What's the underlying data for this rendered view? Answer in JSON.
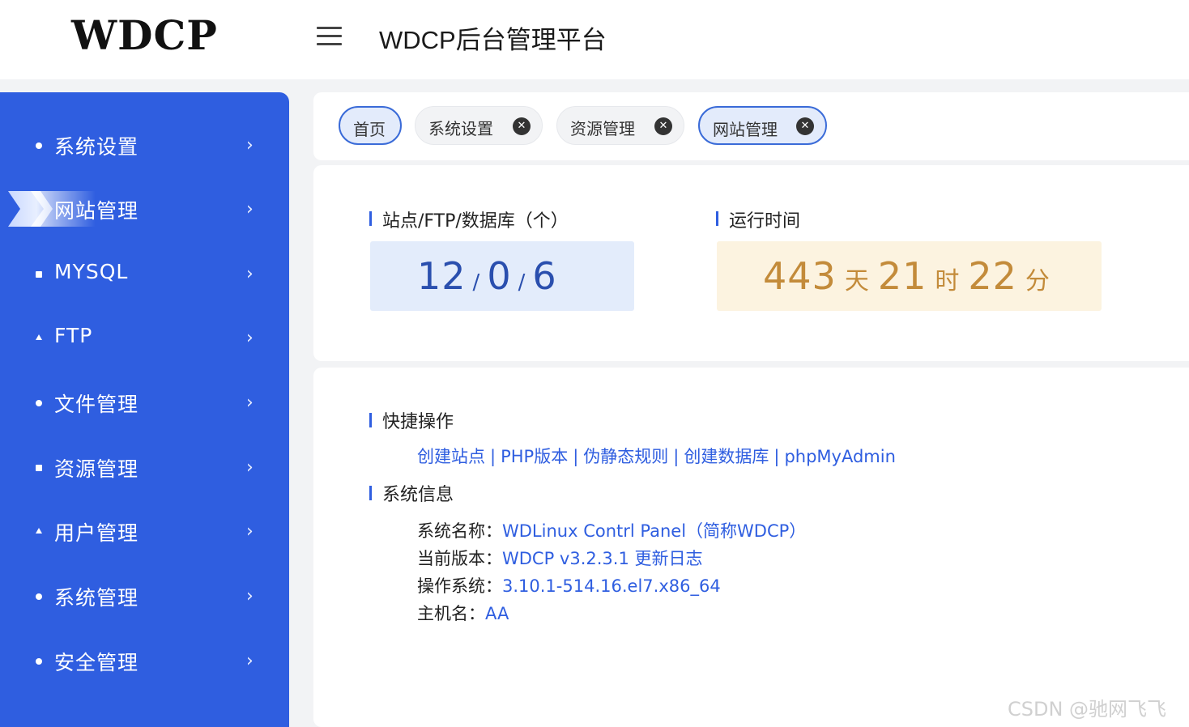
{
  "header": {
    "logo_text": "WDCP",
    "title": "WDCP后台管理平台"
  },
  "sidebar": {
    "items": [
      {
        "label": "系统设置",
        "bullet": "dot"
      },
      {
        "label": "网站管理",
        "bullet": "active"
      },
      {
        "label": "MYSQL",
        "bullet": "square"
      },
      {
        "label": "FTP",
        "bullet": "triangle"
      },
      {
        "label": "文件管理",
        "bullet": "dot"
      },
      {
        "label": "资源管理",
        "bullet": "square"
      },
      {
        "label": "用户管理",
        "bullet": "triangle"
      },
      {
        "label": "系统管理",
        "bullet": "dot"
      },
      {
        "label": "安全管理",
        "bullet": "dot"
      }
    ],
    "chevron": "›",
    "active_index": 1
  },
  "tabs": [
    {
      "label": "首页",
      "closable": false,
      "selected": true
    },
    {
      "label": "系统设置",
      "closable": true,
      "selected": false
    },
    {
      "label": "资源管理",
      "closable": true,
      "selected": false
    },
    {
      "label": "网站管理",
      "closable": true,
      "selected": true
    }
  ],
  "stats": {
    "sites_title": "站点/FTP/数据库（个）",
    "sites": "12",
    "ftp": "0",
    "databases": "6",
    "separator": "/",
    "uptime_title": "运行时间",
    "uptime_days": "443",
    "uptime_days_unit": "天",
    "uptime_hours": "21",
    "uptime_hours_unit": "时",
    "uptime_minutes": "22",
    "uptime_minutes_unit": "分"
  },
  "quick_actions": {
    "title": "快捷操作",
    "links": [
      "创建站点",
      "PHP版本",
      "伪静态规则",
      "创建数据库",
      "phpMyAdmin"
    ],
    "separator": "|"
  },
  "system_info": {
    "title": "系统信息",
    "name_label": "系统名称：",
    "name_value": "WDLinux Contrl Panel（简称WDCP）",
    "version_label": "当前版本：",
    "version_value": "WDCP v3.2.3.1",
    "changelog_link": "更新日志",
    "os_label": "操作系统：",
    "os_value": "3.10.1-514.16.el7.x86_64",
    "host_label": "主机名：",
    "host_value": "AA"
  },
  "watermark": "CSDN @驰网飞飞",
  "colors": {
    "primary": "#2f5ee0",
    "sites_bg": "#e3ecfb",
    "sites_text": "#2a4fae",
    "uptime_bg": "#fcf3e0",
    "uptime_text": "#c38b3a"
  }
}
